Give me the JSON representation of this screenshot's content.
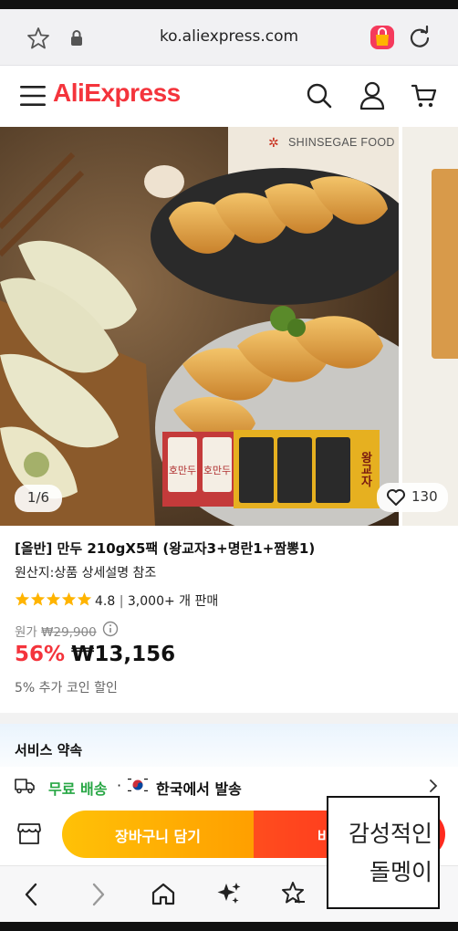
{
  "browser": {
    "url": "ko.aliexpress.com"
  },
  "header": {
    "logo": "AliExpress"
  },
  "gallery": {
    "brand_watermark": "SHINSEGAE FOOD",
    "page_indicator": "1/6",
    "wishlist_count": "130",
    "package_labels": [
      "호만두",
      "호만두",
      "왕교자"
    ]
  },
  "product": {
    "title": "[올반] 만두 210gX5팩 (왕교자3+명란1+짬뽕1)",
    "origin": "원산지:상품 상세설명 참조",
    "rating": "4.8",
    "sold": "3,000+ 개 판매",
    "rating_stars": 5,
    "original_label": "원가",
    "original_price": "₩29,900",
    "discount": "56%",
    "price": "₩13,156",
    "coin_discount": "5% 추가 코인 할인"
  },
  "service": {
    "title": "서비스 약속",
    "free_shipping": "무료 배송",
    "separator": "·",
    "ships_from": "한국에서 발송"
  },
  "actions": {
    "cart": "장바구니 담기",
    "buy": "바로 구매"
  },
  "overlay": {
    "line1": "감성적인",
    "line2": "돌멩이"
  },
  "colors": {
    "brand": "#f4343c",
    "free_shipping": "#28a745",
    "cart_btn": "#ffaa00",
    "buy_btn": "#ff3a1e"
  }
}
